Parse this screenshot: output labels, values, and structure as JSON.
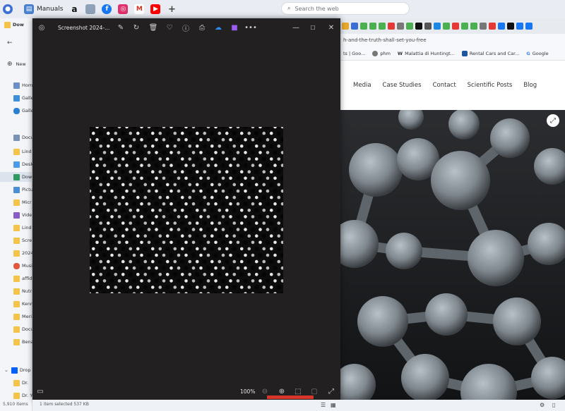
{
  "browser_top": {
    "manuals_label": "Manuals",
    "search_placeholder": "Search the web"
  },
  "explorer": {
    "new_label": "New",
    "items": [
      "Dow",
      "Hom",
      "Galle",
      "Galle",
      "Docu",
      "Lind",
      "Desk",
      "Dow",
      "Pictu",
      "Micr",
      "Vide",
      "Lind",
      "Scre",
      "2024",
      "Musi",
      "affid",
      "Nutr",
      "Kenn",
      "Meri",
      "Docu",
      "Bena",
      "Drop",
      "Dr.",
      "Dr. Young in Gallen Kar"
    ],
    "status_items": "5,910 items",
    "status_selected": "1 item selected  537 KB"
  },
  "viewer": {
    "title": "Screenshot 2024-...",
    "zoom": "100%",
    "more": "•••"
  },
  "browser": {
    "url_fragment": "h-and-the-truth-shall-set-you-free",
    "bookmarks": [
      "ts | Goo...",
      "phm",
      "Malattia di Huntingt...",
      "Rental Cars and Car...",
      "Google"
    ],
    "nav": [
      "Media",
      "Case Studies",
      "Contact",
      "Scientific Posts",
      "Blog"
    ]
  },
  "colors": {
    "viewer_bg": "#222020",
    "accent_red": "#d9362b",
    "hero_bg": "#1a1a1c"
  }
}
